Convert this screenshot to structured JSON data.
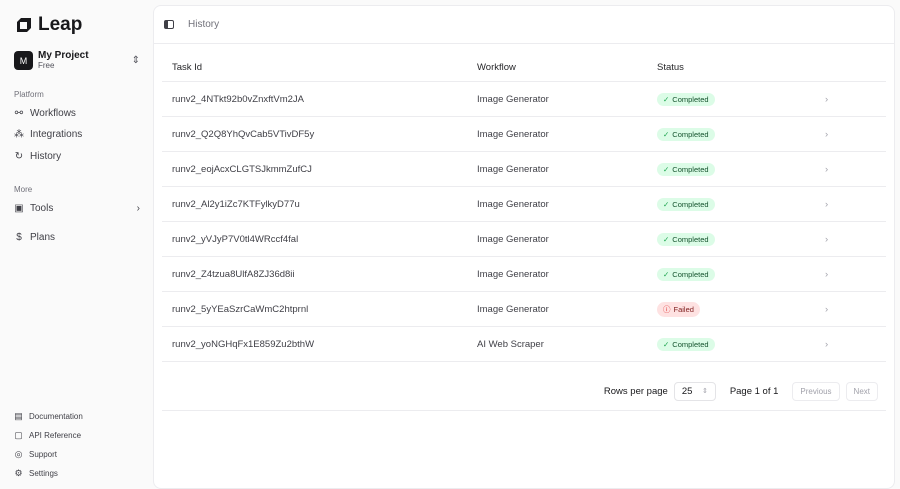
{
  "app": {
    "name": "Leap"
  },
  "project": {
    "initial": "M",
    "name": "My Project",
    "plan": "Free"
  },
  "sidebar": {
    "platform_label": "Platform",
    "platform": [
      {
        "label": "Workflows",
        "icon": "workflow-icon"
      },
      {
        "label": "Integrations",
        "icon": "integrations-icon"
      },
      {
        "label": "History",
        "icon": "history-icon"
      }
    ],
    "more_label": "More",
    "tools": "Tools",
    "plans": "Plans",
    "footer": [
      {
        "label": "Documentation",
        "icon": "book-icon"
      },
      {
        "label": "API Reference",
        "icon": "code-icon"
      },
      {
        "label": "Support",
        "icon": "support-icon"
      },
      {
        "label": "Settings",
        "icon": "gear-icon"
      }
    ]
  },
  "header": {
    "breadcrumb": "History"
  },
  "table": {
    "columns": [
      "Task Id",
      "Workflow",
      "Status"
    ],
    "rows": [
      {
        "id": "runv2_4NTkt92b0vZnxftVm2JA",
        "workflow": "Image Generator",
        "status": "Completed"
      },
      {
        "id": "runv2_Q2Q8YhQvCab5VTivDF5y",
        "workflow": "Image Generator",
        "status": "Completed"
      },
      {
        "id": "runv2_eojAcxCLGTSJkmmZufCJ",
        "workflow": "Image Generator",
        "status": "Completed"
      },
      {
        "id": "runv2_Al2y1iZc7KTFylkyD77u",
        "workflow": "Image Generator",
        "status": "Completed"
      },
      {
        "id": "runv2_yVJyP7V0tl4WRccf4fal",
        "workflow": "Image Generator",
        "status": "Completed"
      },
      {
        "id": "runv2_Z4tzua8UlfA8ZJ36d8ii",
        "workflow": "Image Generator",
        "status": "Completed"
      },
      {
        "id": "runv2_5yYEaSzrCaWmC2htprnl",
        "workflow": "Image Generator",
        "status": "Failed"
      },
      {
        "id": "runv2_yoNGHqFx1E859Zu2bthW",
        "workflow": "AI Web Scraper",
        "status": "Completed"
      }
    ]
  },
  "pagination": {
    "rows_label": "Rows per page",
    "rows_value": "25",
    "page_text": "Page 1 of 1",
    "previous": "Previous",
    "next": "Next"
  }
}
